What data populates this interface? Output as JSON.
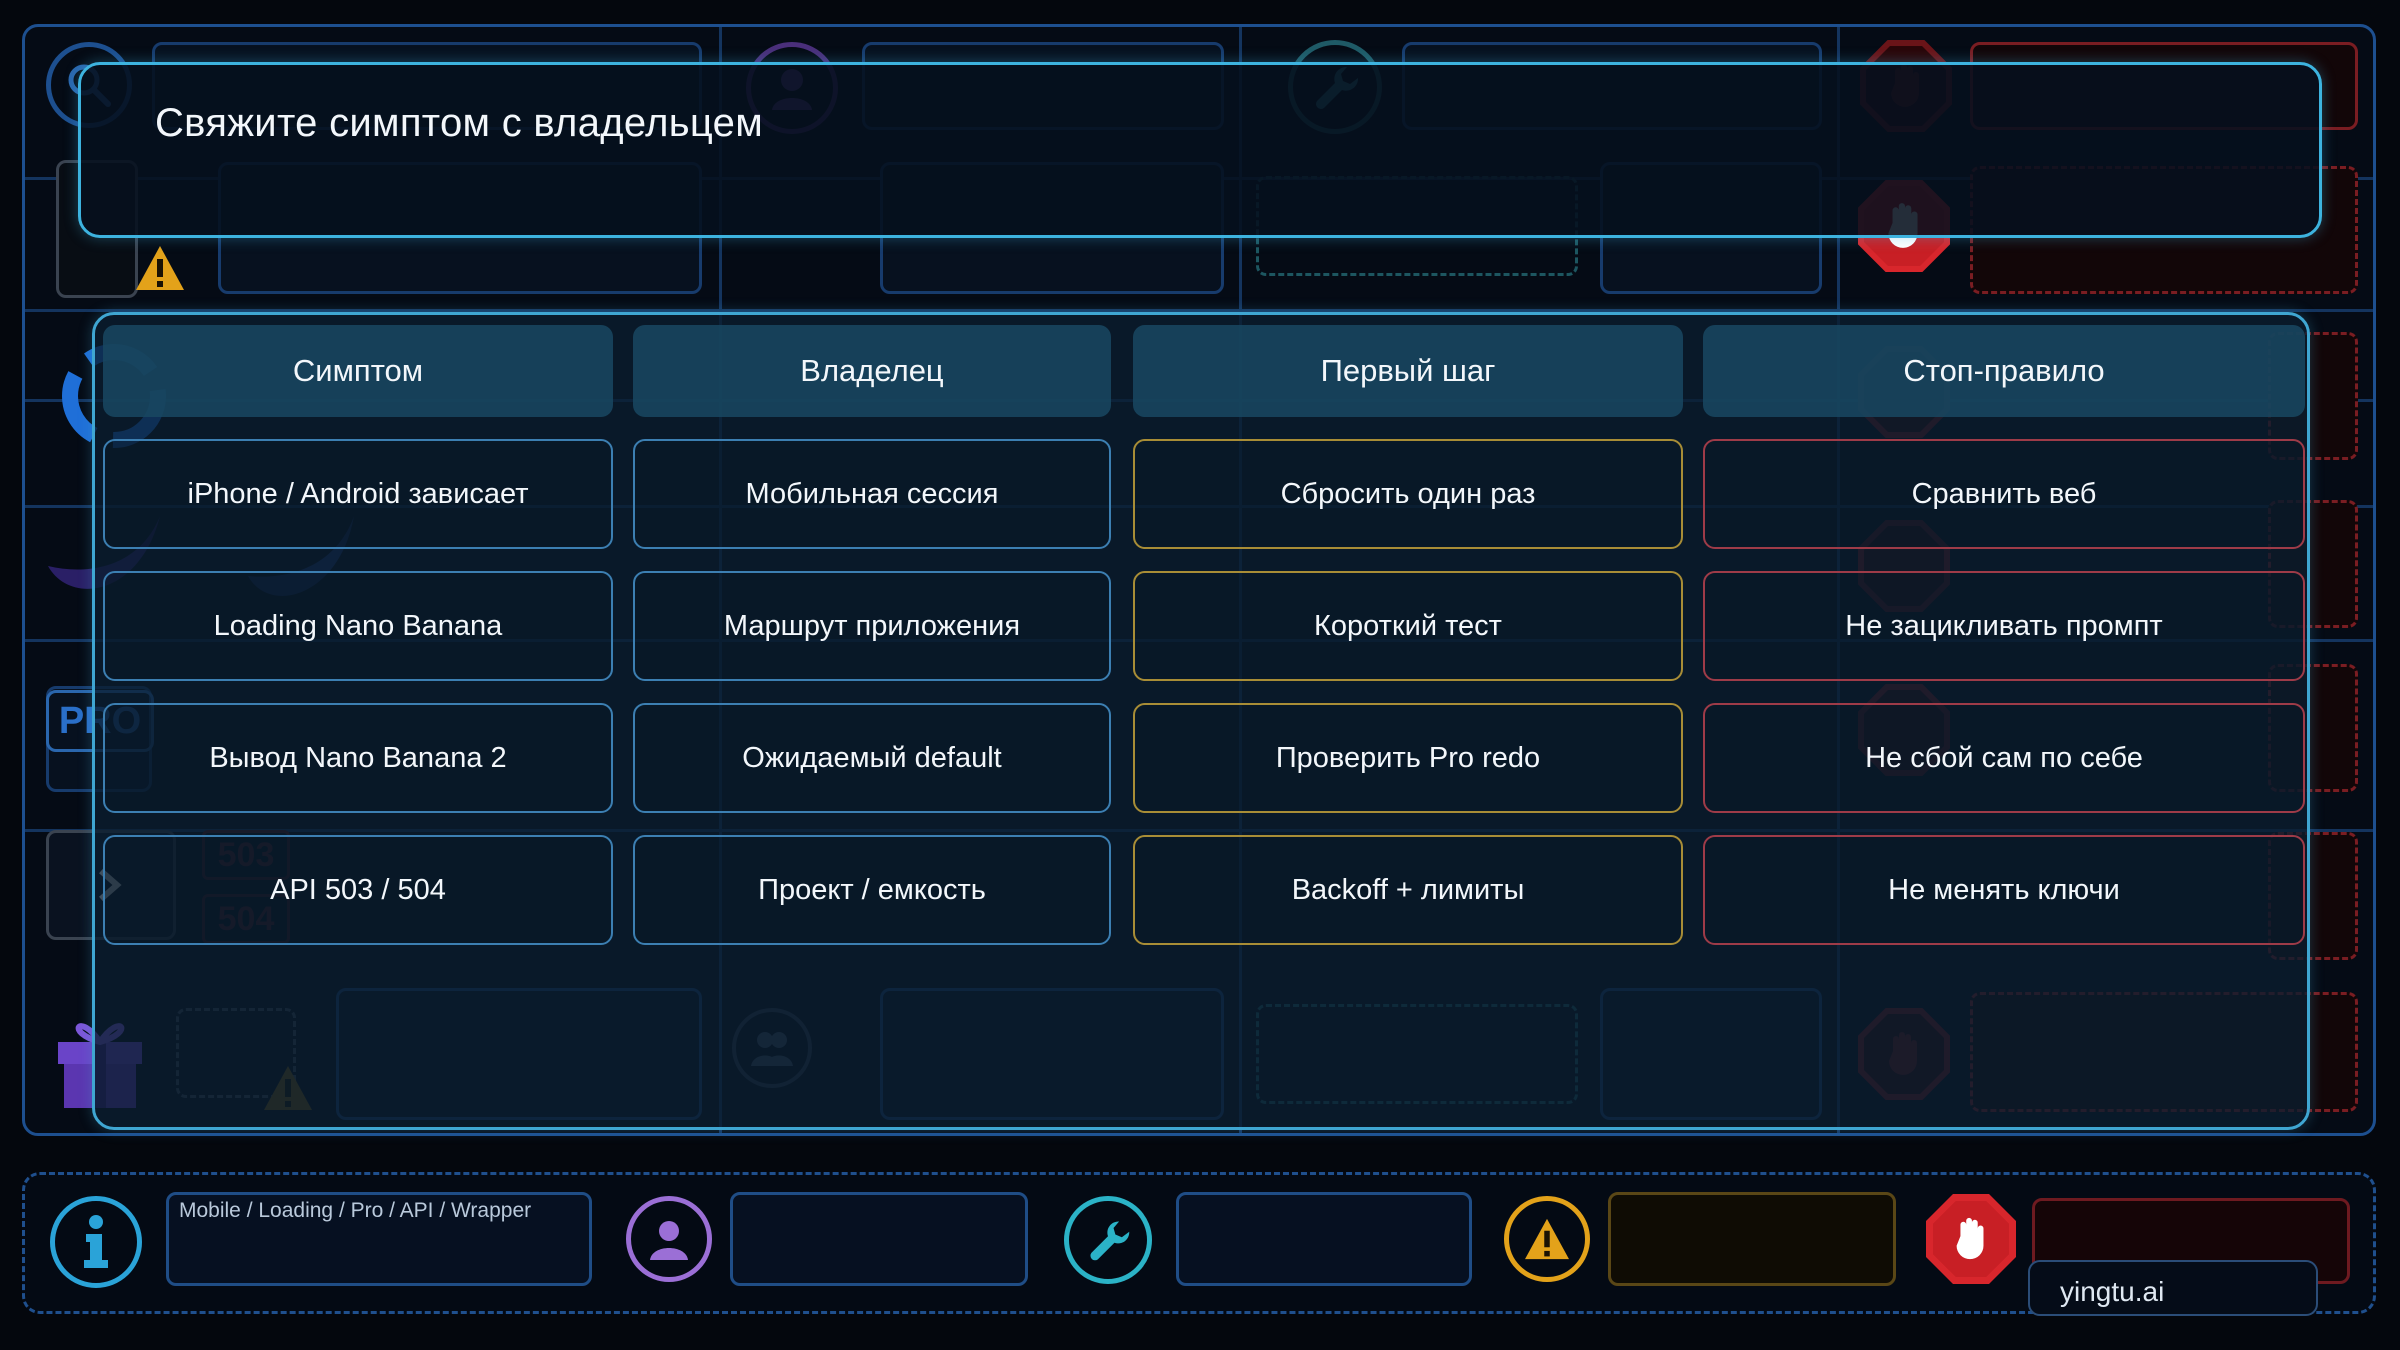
{
  "title": "Свяжите симптом с владельцем",
  "columns": [
    "Симптом",
    "Владелец",
    "Первый шаг",
    "Стоп-правило"
  ],
  "rows": [
    {
      "symptom": "iPhone / Android зависает",
      "owner": "Мобильная сессия",
      "first_step": "Сбросить один раз",
      "stop_rule": "Сравнить веб"
    },
    {
      "symptom": "Loading Nano Banana",
      "owner": "Маршрут приложения",
      "first_step": "Короткий тест",
      "stop_rule": "Не зацикливать промпт"
    },
    {
      "symptom": "Вывод Nano Banana 2",
      "owner": "Ожидаемый default",
      "first_step": "Проверить Pro redo",
      "stop_rule": "Не сбой сам по себе"
    },
    {
      "symptom": "API 503 / 504",
      "owner": "Проект / емкость",
      "first_step": "Backoff + лимиты",
      "stop_rule": "Не менять ключи"
    }
  ],
  "background": {
    "pro_badge": "PRO",
    "error_codes": [
      "503",
      "504"
    ]
  },
  "footer": {
    "breadcrumb": "Mobile / Loading / Pro / API / Wrapper",
    "brand": "yingtu.ai"
  },
  "colors": {
    "title_border": "#3db3df",
    "panel_border": "#3fa6d2",
    "symptom_owner_border": "#3c7fb2",
    "first_step_border": "#a88d36",
    "stop_rule_border": "#9e3b48",
    "footer_info": "#2aa3d8",
    "footer_user": "#9b6fd6",
    "footer_wrench": "#2bb3c7",
    "footer_warning": "#e3a21a",
    "footer_stop": "#d8262c"
  },
  "icons": [
    "search-icon",
    "user-icon",
    "wrench-icon",
    "stop-hand-icon",
    "warning-icon",
    "info-icon",
    "gift-icon",
    "banana-icon",
    "refresh-icon",
    "trash-icon",
    "wifi-icon",
    "filter-icon",
    "globe-icon",
    "code-icon",
    "card-icon",
    "external-link-icon",
    "group-icon",
    "terminal-icon",
    "lock-icon"
  ]
}
